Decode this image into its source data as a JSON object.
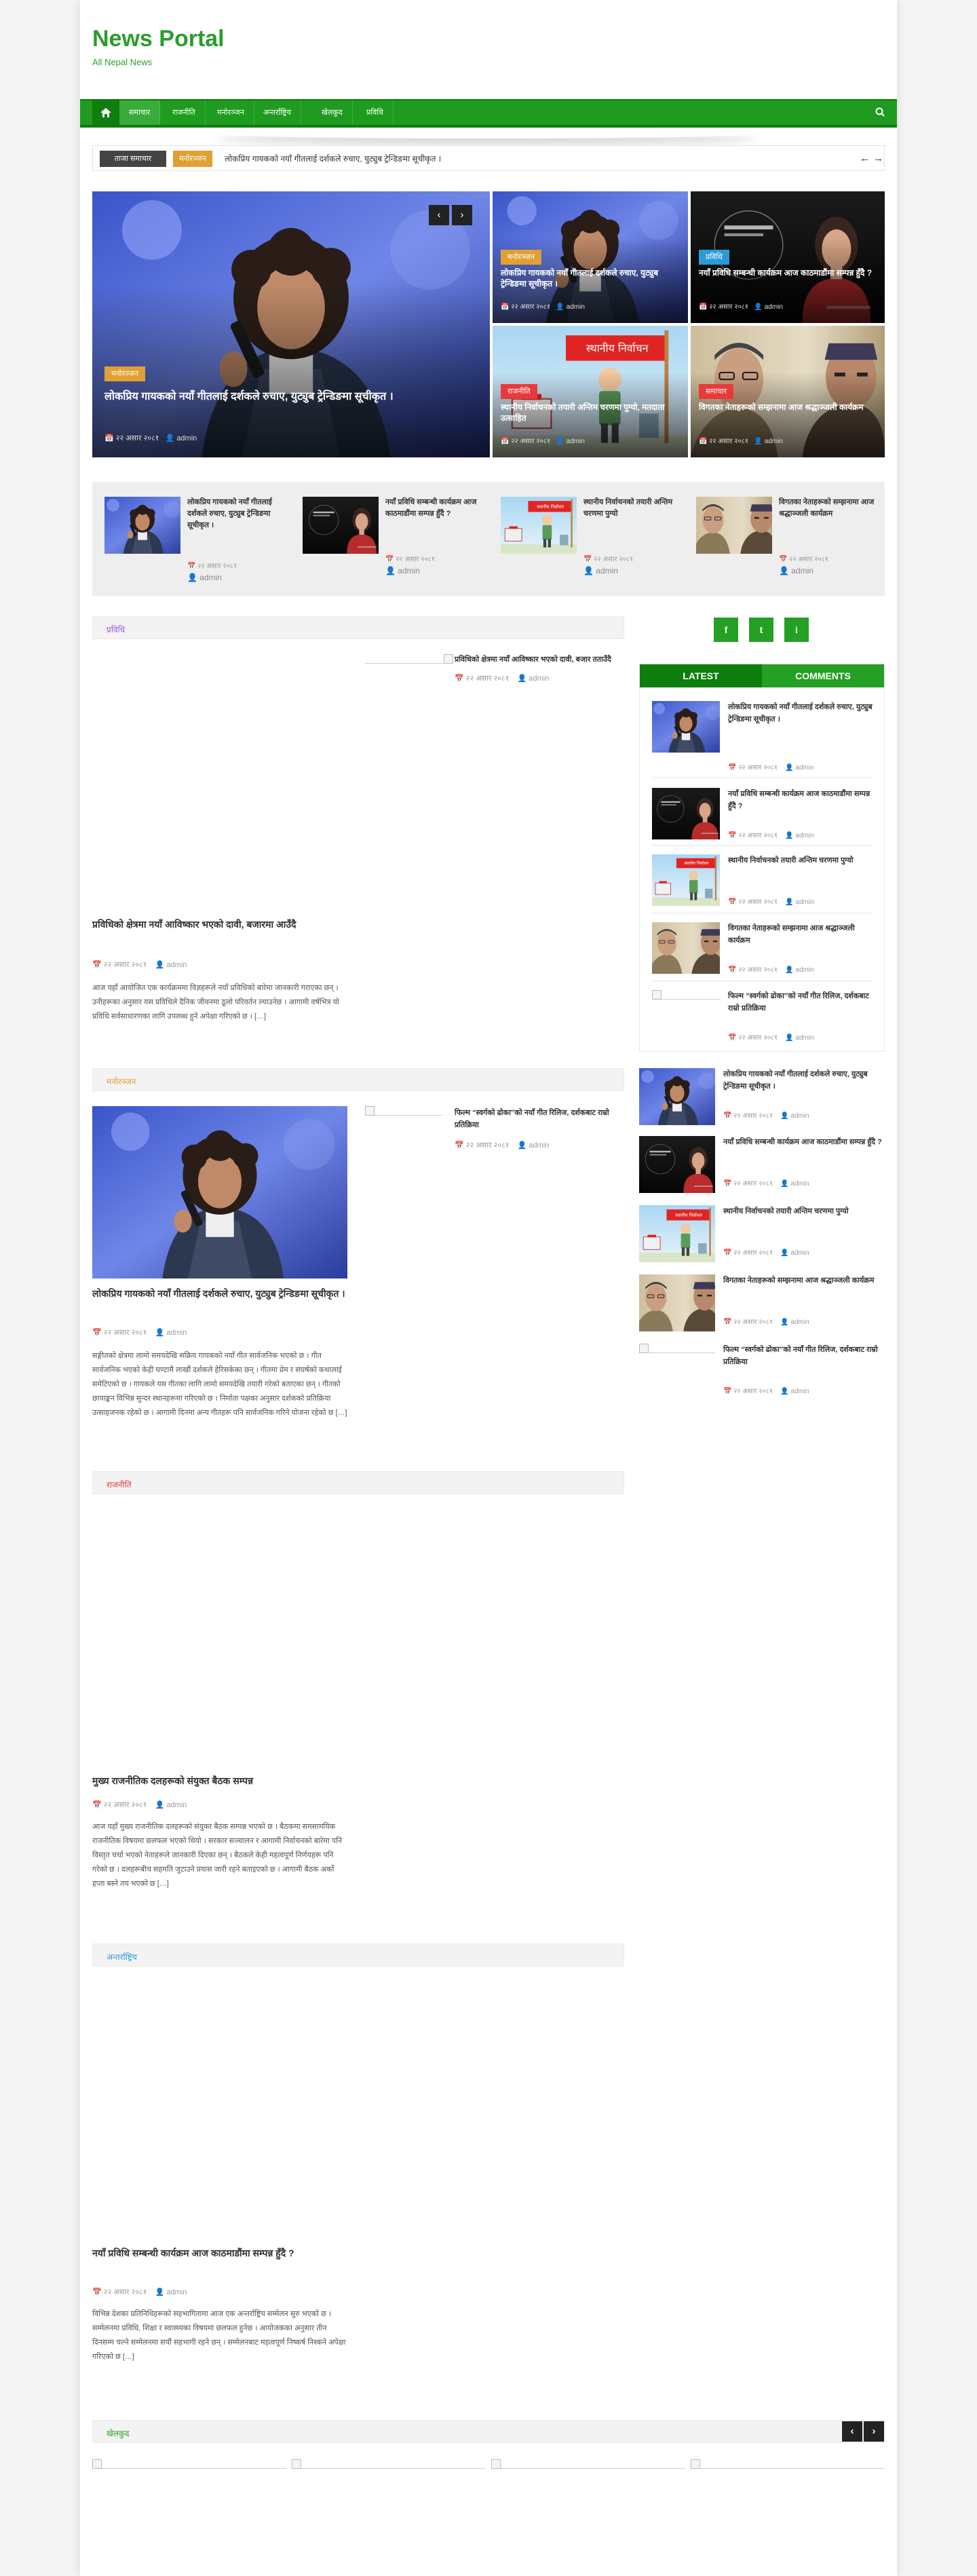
{
  "site": {
    "title": "News Portal",
    "tagline": "All Nepal News"
  },
  "colors": {
    "brand": "#1f9c1f",
    "brand_dark": "#0d7d0d",
    "accent_orange": "#e0a033",
    "accent_red": "#e83a3a",
    "accent_blue": "#2a9bd8",
    "accent_purple": "#9b5ad8"
  },
  "nav": {
    "home_icon": "home-icon",
    "items": [
      "समाचार",
      "राजनीति",
      "मनोरञ्जन",
      "अन्तर्राष्ट्रिय",
      "खेलकुद",
      "प्रविधि"
    ],
    "search_icon": "search-icon"
  },
  "ticker": {
    "label": "ताजा समाचार",
    "badge": "मनोरञ्जन",
    "text": "लोकप्रिय गायकको नयाँ गीतलाई दर्शकले रुचाए, युट्युब ट्रेन्डिङमा सूचीकृत ।"
  },
  "meta": {
    "date": "२२ असार २०८१",
    "author": "admin"
  },
  "hero": {
    "main": {
      "category": "मनोरञ्जन",
      "title": "लोकप्रिय गायकको नयाँ गीतलाई दर्शकले रुचाए, युट्युब ट्रेन्डिङमा सूचीकृत ।"
    },
    "grid": [
      {
        "category": "मनोरञ्जन",
        "title": "लोकप्रिय गायकको नयाँ गीतलाई दर्शकले रुचाए, युट्युब ट्रेन्डिङमा सूचीकृत ।"
      },
      {
        "category": "प्रविधि",
        "title": "नयाँ प्रविधि सम्बन्धी कार्यक्रम आज काठमाडौंमा सम्पन्न हुँदै ?"
      },
      {
        "category": "राजनीति",
        "title": "स्थानीय निर्वाचनको तयारी अन्तिम चरणमा पुग्यो, मतदाता उत्साहित"
      },
      {
        "category": "समाचार",
        "title": "विगतका नेताहरूको सम्झनामा आज श्रद्धाञ्जली कार्यक्रम"
      }
    ],
    "banner_text": "स्थानीय निर्वाचन"
  },
  "strip": [
    {
      "title": "लोकप्रिय गायकको नयाँ गीतलाई दर्शकले रुचाए, युट्युब ट्रेन्डिङमा सूचीकृत ।"
    },
    {
      "title": "नयाँ प्रविधि सम्बन्धी कार्यक्रम आज काठमाडौंमा सम्पन्न हुँदै ?"
    },
    {
      "title": "स्थानीय निर्वाचनको तयारी अन्तिम चरणमा पुग्यो"
    },
    {
      "title": "विगतका नेताहरूको सम्झनामा आज श्रद्धाञ्जली कार्यक्रम"
    }
  ],
  "sections": [
    {
      "label": "प्रविधि",
      "main_title": "प्रविधिको क्षेत्रमा नयाँ आविष्कार भएको दावी, बजारमा आउँदै",
      "excerpt": "आज यहाँ आयोजित एक कार्यक्रममा विज्ञहरूले नयाँ प्रविधिको बारेमा जानकारी गराएका छन् । उनीहरूका अनुसार यस प्रविधिले दैनिक जीवनमा ठूलो परिवर्तन ल्याउनेछ । आगामी वर्षभित्र यो प्रविधि सर्वसाधारणका लागि उपलब्ध हुने अपेक्षा गरिएको छ । […]",
      "side": [
        {
          "title": "प्रविधिको क्षेत्रमा नयाँ आविष्कार भएको दावी, बजार तताउँदै"
        }
      ]
    },
    {
      "label": "मनोरञ्जन",
      "main_title": "लोकप्रिय गायकको नयाँ गीतलाई दर्शकले रुचाए, युट्युब ट्रेन्डिङमा सूचीकृत ।",
      "excerpt": "सङ्गीतको क्षेत्रमा लामो समयदेखि सक्रिय गायकको नयाँ गीत सार्वजनिक भएको छ । गीत सार्वजनिक भएको केही घण्टामै लाखौं दर्शकले हेरिसकेका छन् । गीतमा प्रेम र संघर्षको कथालाई समेटिएको छ । गायकले यस गीतका लागि लामो समयदेखि तयारी गरेको बताएका छन् । गीतको छायाङ्कन विभिन्न सुन्दर स्थानहरूमा गरिएको छ । निर्माता पक्षका अनुसार दर्शकको प्रतिक्रिया उत्साहजनक रहेको छ । आगामी दिनमा अन्य गीतहरू पनि सार्वजनिक गरिने योजना रहेको छ […]",
      "side": [
        {
          "title": "फिल्म “स्वर्गको ढोका”को नयाँ गीत रिलिज, दर्शकबाट राम्रो प्रतिक्रिया"
        }
      ]
    },
    {
      "label": "राजनीति",
      "main_title": "मुख्य राजनीतिक दलहरूको संयुक्त बैठक सम्पन्न",
      "excerpt": "आज यहाँ मुख्य राजनीतिक दलहरूको संयुक्त बैठक सम्पन्न भएको छ । बैठकमा समसामयिक राजनीतिक विषयमा छलफल भएको थियो । सरकार सञ्चालन र आगामी निर्वाचनको बारेमा पनि विस्तृत चर्चा भएको नेताहरूले जानकारी दिएका छन् । बैठकले केही महत्वपूर्ण निर्णयहरू पनि गरेको छ । दलहरूबीच सहमति जुटाउने प्रयास जारी रहने बताइएको छ । आगामी बैठक अर्को हप्ता बस्ने तय भएको छ […]",
      "side": []
    },
    {
      "label": "अन्तर्राष्ट्रिय",
      "main_title": "नयाँ प्रविधि सम्बन्धी कार्यक्रम आज काठमाडौंमा सम्पन्न हुँदै ?",
      "excerpt": "विभिन्न देशका प्रतिनिधिहरूको सहभागितामा आज एक अन्तर्राष्ट्रिय सम्मेलन सुरु भएको छ । सम्मेलनमा प्रविधि, शिक्षा र स्वास्थ्यका विषयमा छलफल हुनेछ । आयोजकका अनुसार तीन दिनसम्म चल्ने सम्मेलनमा सयौं सहभागी रहने छन् । सम्मेलनबाट महत्वपूर्ण निष्कर्ष निस्कने अपेक्षा गरिएको छ […]",
      "side": []
    }
  ],
  "bottom": {
    "label": "खेलकुद"
  },
  "sidebar": {
    "social": [
      "f",
      "t",
      "i"
    ],
    "tabs": [
      "LATEST",
      "COMMENTS"
    ],
    "latest": [
      {
        "title": "लोकप्रिय गायकको नयाँ गीतलाई दर्शकले रुचाए, युट्युब ट्रेन्डिङमा सूचीकृत ।"
      },
      {
        "title": "नयाँ प्रविधि सम्बन्धी कार्यक्रम आज काठमाडौंमा सम्पन्न हुँदै ?"
      },
      {
        "title": "स्थानीय निर्वाचनको तयारी अन्तिम चरणमा पुग्यो"
      },
      {
        "title": "विगतका नेताहरूको सम्झनामा आज श्रद्धाञ्जली कार्यक्रम"
      },
      {
        "title": "फिल्म “स्वर्गको ढोका”को नयाँ गीत रिलिज, दर्शकबाट राम्रो प्रतिक्रिया"
      }
    ],
    "list": [
      {
        "title": "लोकप्रिय गायकको नयाँ गीतलाई दर्शकले रुचाए, युट्युब ट्रेन्डिङमा सूचीकृत ।"
      },
      {
        "title": "नयाँ प्रविधि सम्बन्धी कार्यक्रम आज काठमाडौंमा सम्पन्न हुँदै ?"
      },
      {
        "title": "स्थानीय निर्वाचनको तयारी अन्तिम चरणमा पुग्यो"
      },
      {
        "title": "विगतका नेताहरूको सम्झनामा आज श्रद्धाञ्जली कार्यक्रम"
      },
      {
        "title": "फिल्म “स्वर्गको ढोका”को नयाँ गीत रिलिज, दर्शकबाट राम्रो प्रतिक्रिया"
      }
    ]
  }
}
